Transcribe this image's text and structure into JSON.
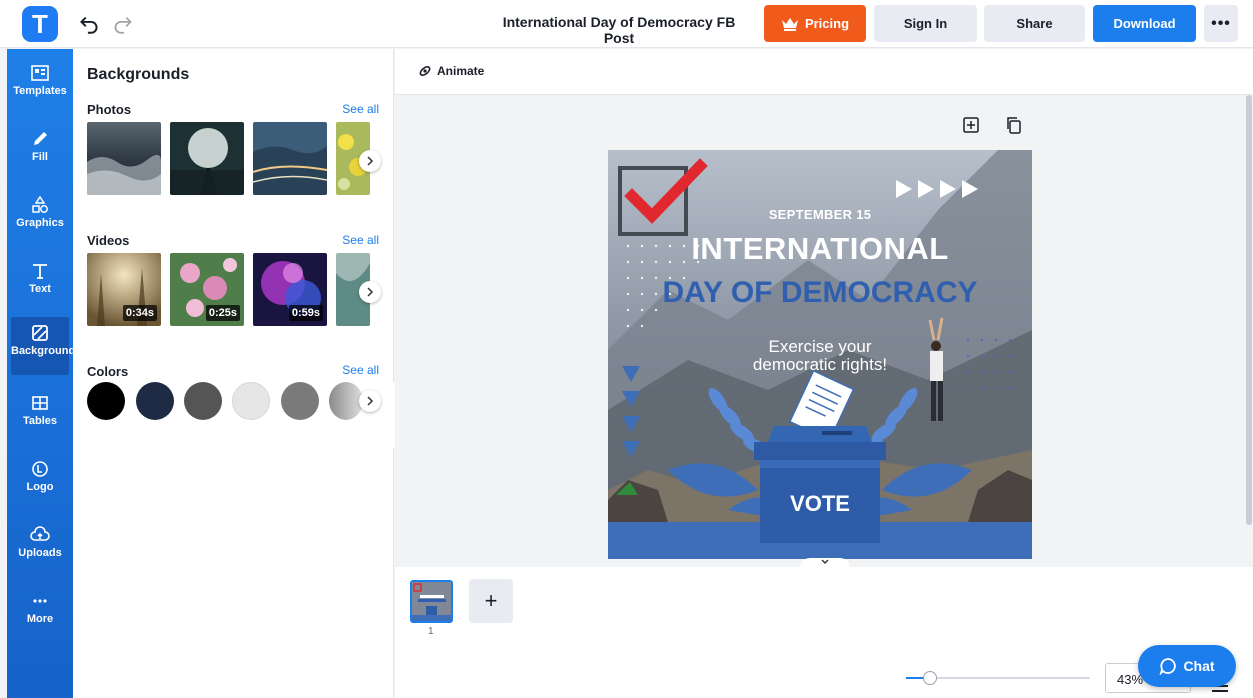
{
  "app": {
    "logo_letter": "T",
    "doc_title": "International Day of Democracy FB Post",
    "accent": "#1c7ded",
    "pricing_color": "#f05a1b"
  },
  "topbar": {
    "pricing_label": "Pricing",
    "signin_label": "Sign In",
    "share_label": "Share",
    "download_label": "Download",
    "more_label": "•••"
  },
  "rail": {
    "items": [
      {
        "label": "Templates",
        "icon": "templates-icon"
      },
      {
        "label": "Fill",
        "icon": "pen-icon"
      },
      {
        "label": "Graphics",
        "icon": "shapes-icon"
      },
      {
        "label": "Text",
        "icon": "text-icon"
      },
      {
        "label": "Background",
        "icon": "background-icon",
        "active": true
      },
      {
        "label": "Tables",
        "icon": "table-icon"
      },
      {
        "label": "Logo",
        "icon": "logo-icon"
      },
      {
        "label": "Uploads",
        "icon": "upload-cloud-icon"
      },
      {
        "label": "More",
        "icon": "more-dots-icon"
      }
    ]
  },
  "panel": {
    "title": "Backgrounds",
    "photos": {
      "title": "Photos",
      "see_all": "See all"
    },
    "videos": {
      "title": "Videos",
      "see_all": "See all",
      "durations": [
        "0:34s",
        "0:25s",
        "0:59s"
      ]
    },
    "colors": {
      "title": "Colors",
      "see_all": "See all",
      "swatches": [
        "#000000",
        "#1f2a44",
        "#555555",
        "#e6e6e6",
        "#7a7a7a",
        "#b3b3b3"
      ]
    }
  },
  "toolbar": {
    "animate_label": "Animate"
  },
  "design": {
    "date": "SEPTEMBER 15",
    "headline1": "INTERNATIONAL",
    "headline2": "DAY OF DEMOCRACY",
    "tagline1": "Exercise your",
    "tagline2": "democratic rights!",
    "box_label": "VOTE"
  },
  "pages": {
    "current": "1",
    "add_label": "+"
  },
  "zoom": {
    "value": "43%",
    "level": 0.1
  },
  "chat": {
    "label": "Chat"
  }
}
